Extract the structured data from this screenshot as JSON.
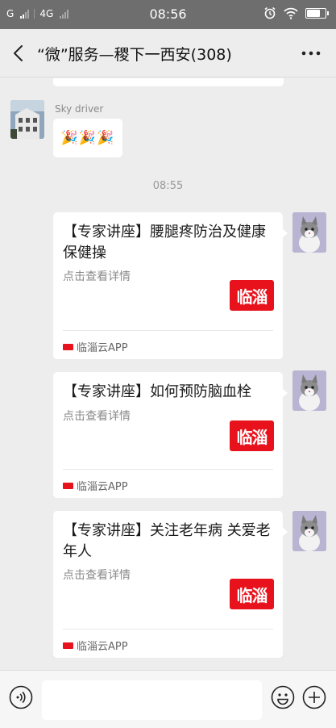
{
  "status_bar": {
    "carrier1": "G",
    "carrier2": "4G",
    "time": "08:56",
    "battery_level": 0.75,
    "icons": [
      "alarm-icon",
      "wifi-icon",
      "battery-icon"
    ]
  },
  "nav": {
    "title": "“微”服务—稷下一西安(308)",
    "back_icon": "chevron-left-icon",
    "more_icon": "more-dots-icon"
  },
  "chat": {
    "sender_name": "Sky driver",
    "emoji_message": "🎉🎉🎉",
    "timestamp": "08:55",
    "cards": [
      {
        "title": "【专家讲座】腰腿疼防治及健康保健操",
        "desc": "点击查看详情",
        "logo_text": "临淄",
        "source": "临淄云APP"
      },
      {
        "title": "【专家讲座】如何预防脑血栓",
        "desc": "点击查看详情",
        "logo_text": "临淄",
        "source": "临淄云APP"
      },
      {
        "title": "【专家讲座】关注老年病 关爱老年人",
        "desc": "点击查看详情",
        "logo_text": "临淄",
        "source": "临淄云APP"
      }
    ]
  },
  "input_bar": {
    "placeholder": "",
    "icons": [
      "voice-icon",
      "emoji-icon",
      "plus-icon"
    ]
  },
  "colors": {
    "status_bar_bg": "#6e6e6e",
    "chat_bg": "#ededed",
    "brand_red": "#e8121c"
  }
}
